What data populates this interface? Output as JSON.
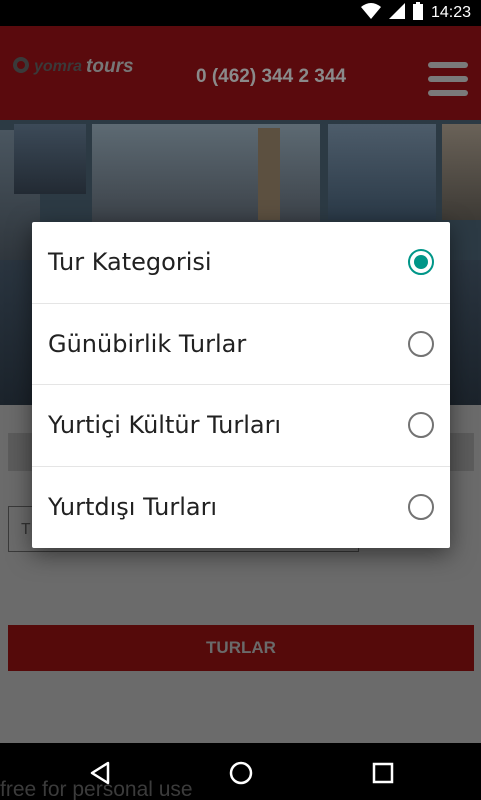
{
  "status_bar": {
    "time": "14:23"
  },
  "header": {
    "logo_part1": "yomra",
    "logo_part2": "tours",
    "phone": "0 (462) 344 2 344"
  },
  "form": {
    "select_placeholder": "T",
    "turlar_label": "TURLAR"
  },
  "dialog": {
    "options": [
      {
        "label": "Tur Kategorisi",
        "selected": true
      },
      {
        "label": "Günübirlik Turlar",
        "selected": false
      },
      {
        "label": "Yurtiçi Kültür Turları",
        "selected": false
      },
      {
        "label": "Yurtdışı Turları",
        "selected": false
      }
    ]
  },
  "watermark": "free for personal use",
  "colors": {
    "accent": "#009688",
    "header": "#5a0a0d",
    "button": "#550a0a"
  }
}
